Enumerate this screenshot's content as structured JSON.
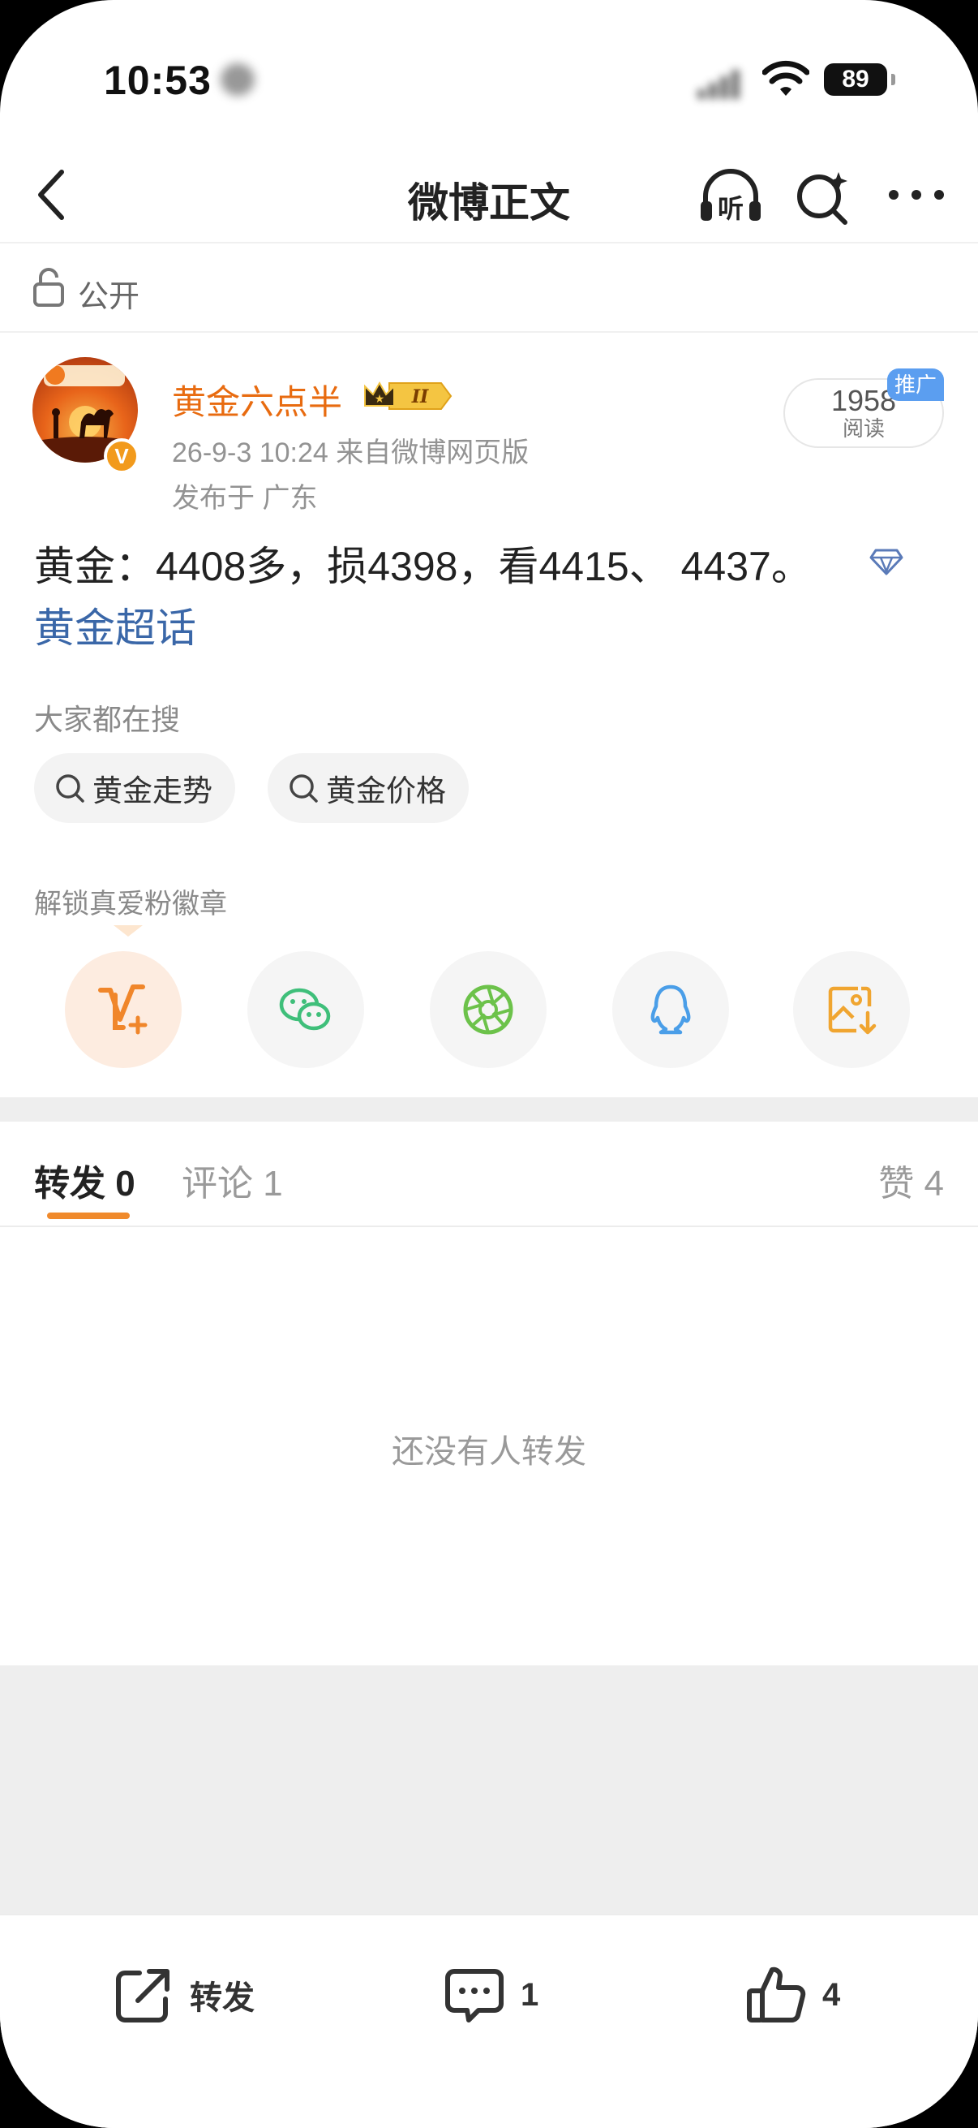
{
  "status_bar": {
    "time": "10:53",
    "battery": "89"
  },
  "nav": {
    "title": "微博正文",
    "listen_icon_text": "听"
  },
  "visibility": {
    "label": "公开"
  },
  "author": {
    "name": "黄金六点半",
    "vip_level": "II",
    "verify_mark": "V",
    "post_time": "26-9-3 10:24  来自微博网页版",
    "location": "发布于 广东",
    "read_count": "1958",
    "read_label": "阅读",
    "promo_label": "推广"
  },
  "post": {
    "text": "黄金：4408多，损4398，看4415、 4437。",
    "topic": "黄金超话"
  },
  "search": {
    "heading": "大家都在搜",
    "chips": [
      "黄金走势",
      "黄金价格"
    ]
  },
  "unlock": {
    "heading": "解锁真爱粉徽章"
  },
  "share_icons": [
    "vip-add-icon",
    "wechat-icon",
    "moments-icon",
    "qq-icon",
    "save-image-icon"
  ],
  "tabs": {
    "repost": "转发 0",
    "comment": "评论 1",
    "like": "赞 4"
  },
  "empty_message": "还没有人转发",
  "bottom_bar": {
    "repost": "转发",
    "comment": "1",
    "like": "4"
  },
  "colors": {
    "accent": "#e86b10",
    "topic": "#3a67a8",
    "tab_indicator": "#f08a2c"
  }
}
